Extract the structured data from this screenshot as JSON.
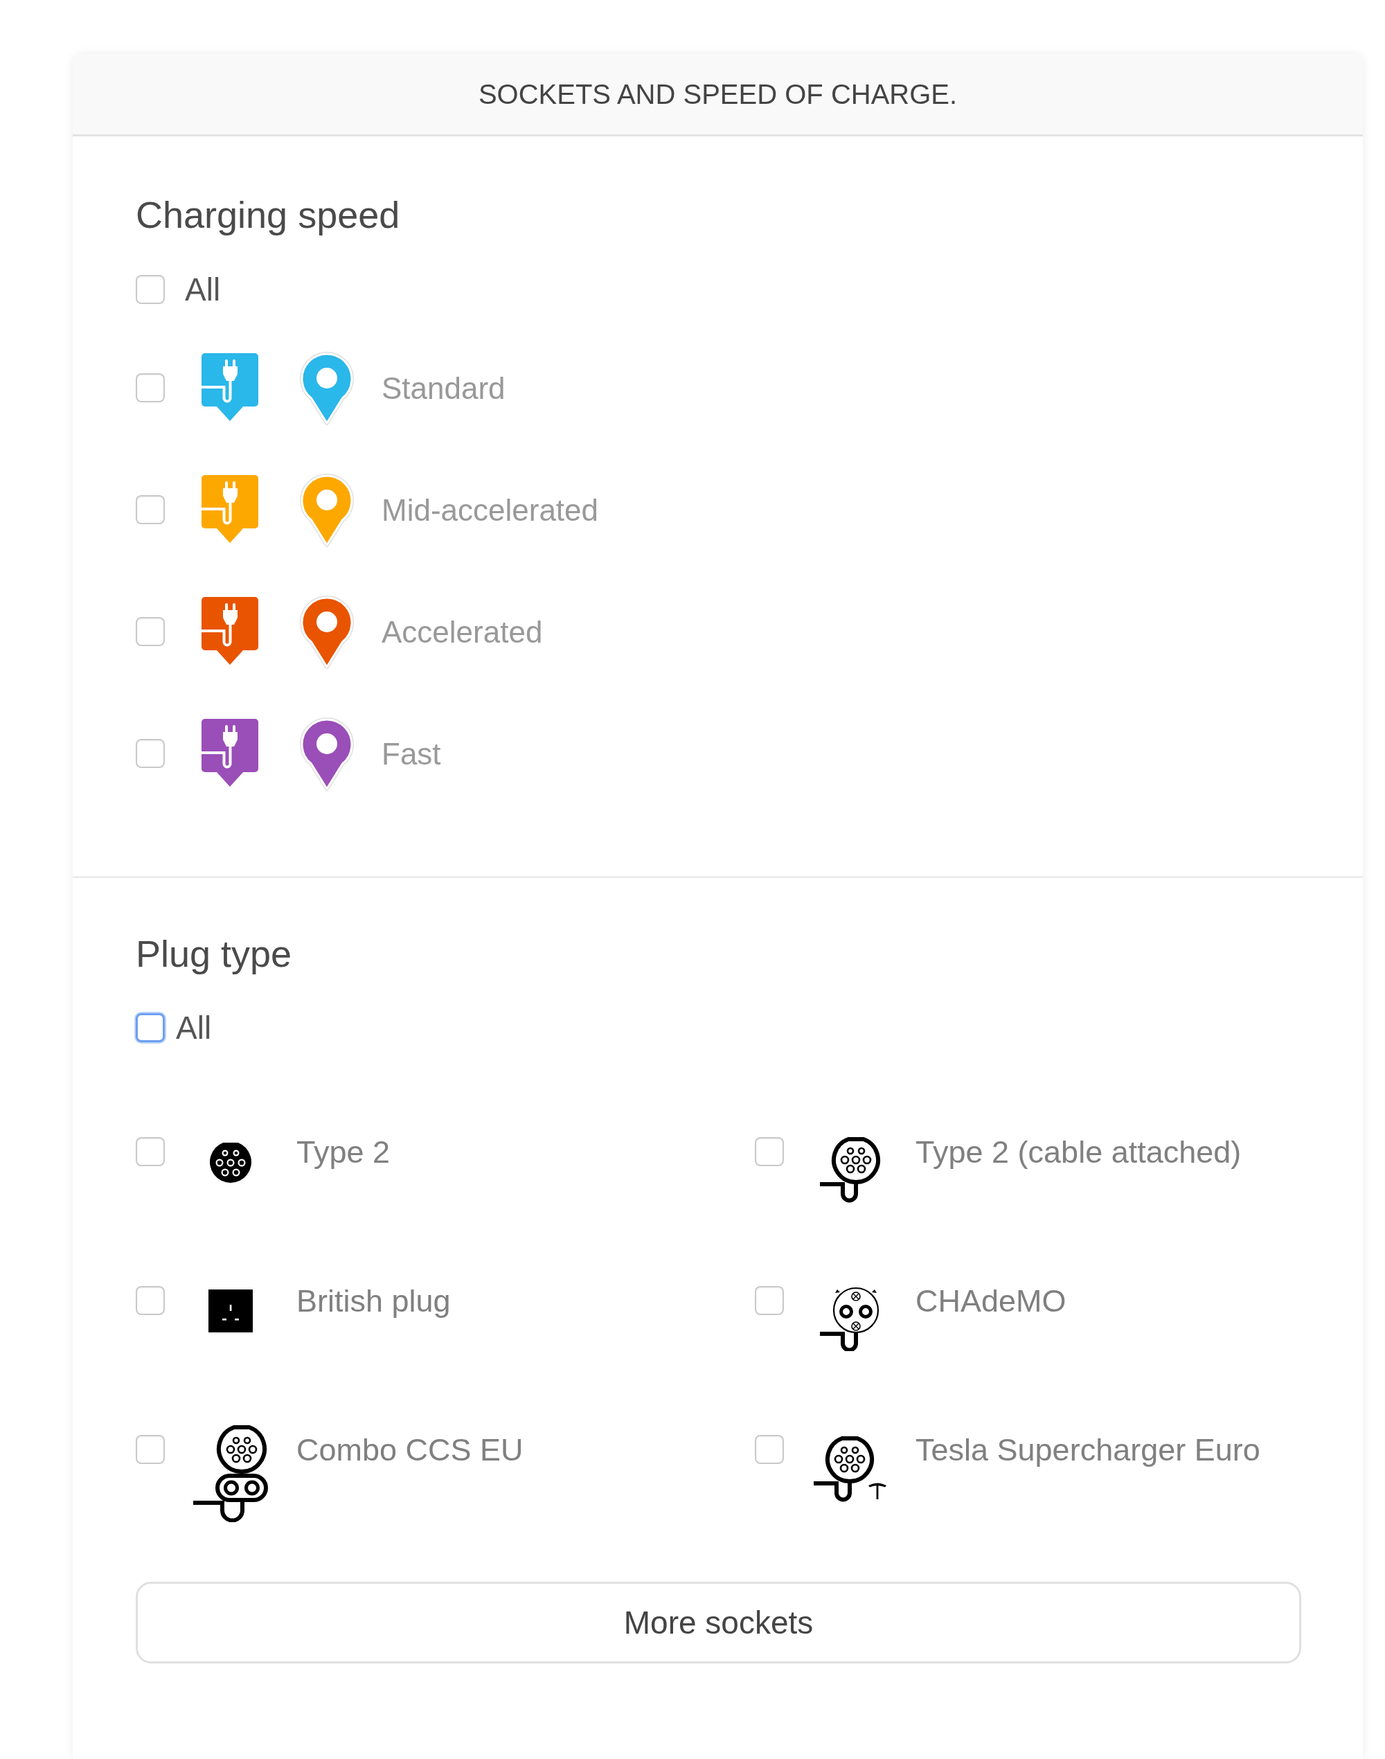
{
  "panel": {
    "title": "SOCKETS AND SPEED OF CHARGE."
  },
  "charging_speed": {
    "title": "Charging speed",
    "all": {
      "label": "All",
      "checked": false,
      "focused": false
    },
    "items": [
      {
        "label": "Standard",
        "color": "#2ab7ea",
        "checked": false
      },
      {
        "label": "Mid-accelerated",
        "color": "#fda800",
        "checked": false
      },
      {
        "label": "Accelerated",
        "color": "#e95400",
        "checked": false
      },
      {
        "label": "Fast",
        "color": "#9a4eb8",
        "checked": false
      }
    ]
  },
  "plug_type": {
    "title": "Plug type",
    "all": {
      "label": "All",
      "checked": false,
      "focused": true
    },
    "items": [
      {
        "label": "Type 2",
        "kind": "type2",
        "checked": false
      },
      {
        "label": "Type 2 (cable attached)",
        "kind": "type2_cable",
        "checked": false
      },
      {
        "label": "British plug",
        "kind": "british",
        "checked": false
      },
      {
        "label": "CHAdeMO",
        "kind": "chademo",
        "checked": false
      },
      {
        "label": "Combo CCS EU",
        "kind": "combo",
        "checked": false
      },
      {
        "label": "Tesla Supercharger Euro",
        "kind": "tesla",
        "checked": false
      }
    ],
    "more_button": "More sockets"
  }
}
